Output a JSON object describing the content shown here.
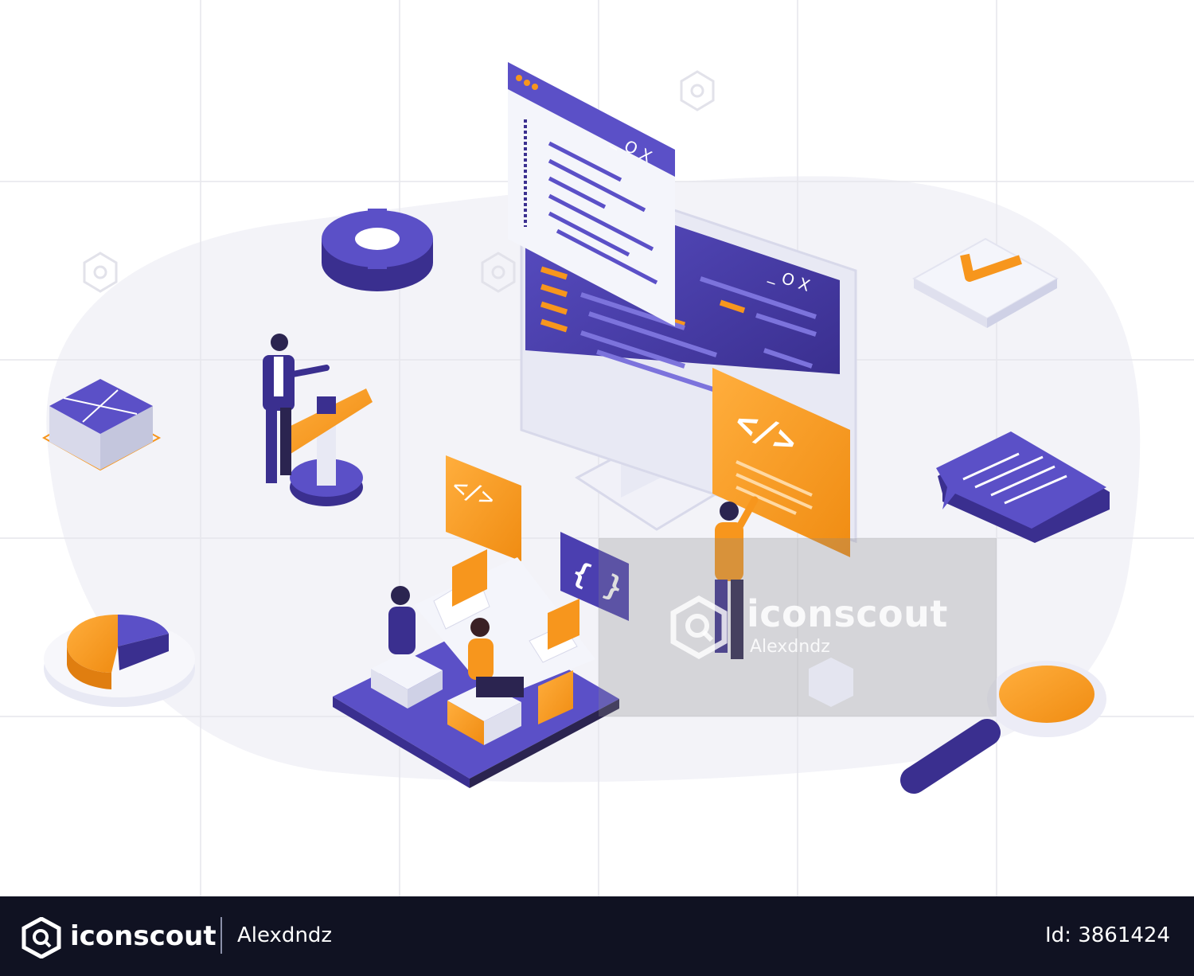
{
  "watermark": {
    "brand": "iconscout",
    "author": "Alexdndz"
  },
  "footer": {
    "brand": "iconscout",
    "author": "Alexdndz",
    "asset_id": "Id: 3861424"
  },
  "illustration": {
    "code_tag": "</>",
    "braces": "{ }",
    "window_controls": "_ O X",
    "colors": {
      "primary": "#4b3fb0",
      "primary_dark": "#3a2f8f",
      "accent": "#f7961d",
      "light": "#eceef8",
      "background": "#ffffff"
    }
  }
}
